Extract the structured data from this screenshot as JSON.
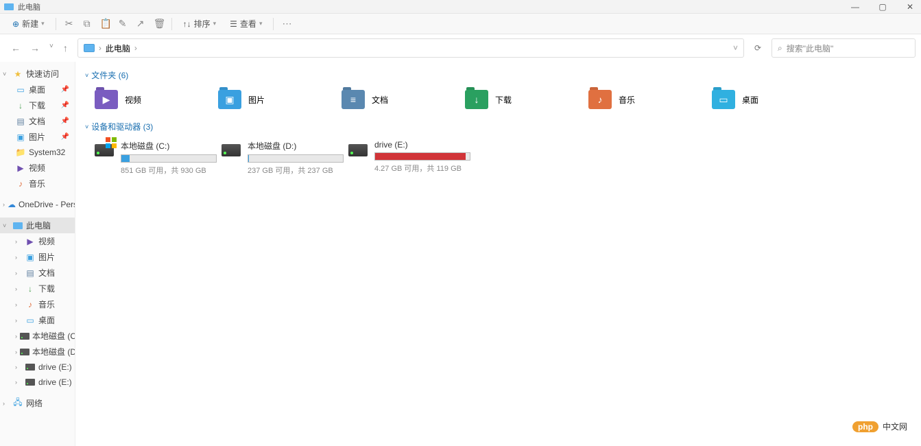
{
  "title_bar": {
    "title": "此电脑"
  },
  "toolbar": {
    "new_label": "新建",
    "sort_label": "排序",
    "view_label": "查看"
  },
  "address": {
    "location": "此电脑",
    "separator": "›"
  },
  "search": {
    "placeholder": "搜索\"此电脑\""
  },
  "sidebar": {
    "quick_access_label": "快速访问",
    "quick_items": [
      {
        "label": "桌面",
        "icon": "desktop",
        "pinned": true
      },
      {
        "label": "下载",
        "icon": "download",
        "pinned": true
      },
      {
        "label": "文档",
        "icon": "doc",
        "pinned": true
      },
      {
        "label": "图片",
        "icon": "pic",
        "pinned": true
      },
      {
        "label": "System32",
        "icon": "folder",
        "pinned": false
      },
      {
        "label": "视频",
        "icon": "video",
        "pinned": false
      },
      {
        "label": "音乐",
        "icon": "music",
        "pinned": false
      }
    ],
    "onedrive_label": "OneDrive - Person",
    "this_pc_label": "此电脑",
    "pc_items": [
      {
        "label": "视频",
        "icon": "video"
      },
      {
        "label": "图片",
        "icon": "pic"
      },
      {
        "label": "文档",
        "icon": "doc"
      },
      {
        "label": "下载",
        "icon": "download"
      },
      {
        "label": "音乐",
        "icon": "music"
      },
      {
        "label": "桌面",
        "icon": "desktop"
      },
      {
        "label": "本地磁盘 (C:)",
        "icon": "disk"
      },
      {
        "label": "本地磁盘 (D:)",
        "icon": "disk"
      },
      {
        "label": "drive (E:)",
        "icon": "disk"
      },
      {
        "label": "drive (E:)",
        "icon": "disk"
      }
    ],
    "network_label": "网络"
  },
  "sections": {
    "folders_label": "文件夹 (6)",
    "drives_label": "设备和驱动器 (3)"
  },
  "folders": [
    {
      "label": "视频",
      "color": "#7a5cc0",
      "glyph": "▶"
    },
    {
      "label": "图片",
      "color": "#3aa0e0",
      "glyph": "▣"
    },
    {
      "label": "文档",
      "color": "#5a88b0",
      "glyph": "≡"
    },
    {
      "label": "下载",
      "color": "#2aa060",
      "glyph": "↓"
    },
    {
      "label": "音乐",
      "color": "#e07040",
      "glyph": "♪"
    },
    {
      "label": "桌面",
      "color": "#30b0e0",
      "glyph": "▭"
    }
  ],
  "drives": [
    {
      "name": "本地磁盘 (C:)",
      "stat": "851 GB 可用，共 930 GB",
      "fill_pct": 9,
      "fill_class": "blue",
      "os": true
    },
    {
      "name": "本地磁盘 (D:)",
      "stat": "237 GB 可用，共 237 GB",
      "fill_pct": 1,
      "fill_class": "blue",
      "os": false
    },
    {
      "name": "drive (E:)",
      "stat": "4.27 GB 可用，共 119 GB",
      "fill_pct": 96,
      "fill_class": "red",
      "os": false
    }
  ],
  "watermark": {
    "badge": "php",
    "text": "中文网"
  }
}
